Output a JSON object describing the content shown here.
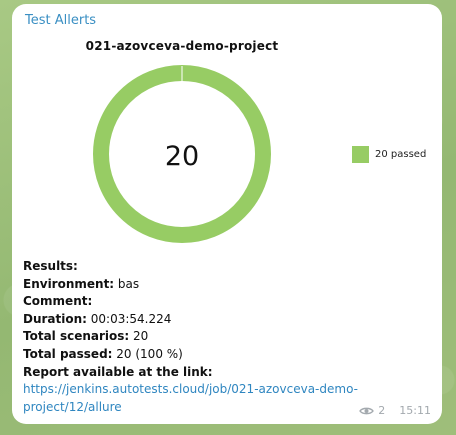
{
  "sender": "Test Allerts",
  "chart_data": {
    "type": "pie",
    "title": "021-azovceva-demo-project",
    "center_label": "20",
    "slices": [
      {
        "name": "20 passed",
        "label": "passed",
        "value": 20,
        "color": "#97cc64"
      }
    ],
    "legend": {
      "placement": "right",
      "entries": [
        "20 passed"
      ]
    }
  },
  "results": {
    "heading": "Results:",
    "environment_label": "Environment:",
    "environment_value": " bas",
    "comment_label": "Comment:",
    "duration_label": "Duration:",
    "duration_value": " 00:03:54.224",
    "total_scenarios_label": "Total scenarios:",
    "total_scenarios_value": " 20",
    "total_passed_label": "Total passed:",
    "total_passed_value": " 20 (100 %)",
    "report_label": "Report available at the link:",
    "report_link": "https://jenkins.autotests.cloud/job/021-azovceva-demo-project/12/allure",
    "report_link_line1": "https://jenkins.autotests.cloud/job/021-azovceva-demo-",
    "report_link_line2": "project/12/allure"
  },
  "meta": {
    "views": "2",
    "time": "15:11",
    "muted_color": "#a3a9ae",
    "link_color": "#2f86c0"
  }
}
